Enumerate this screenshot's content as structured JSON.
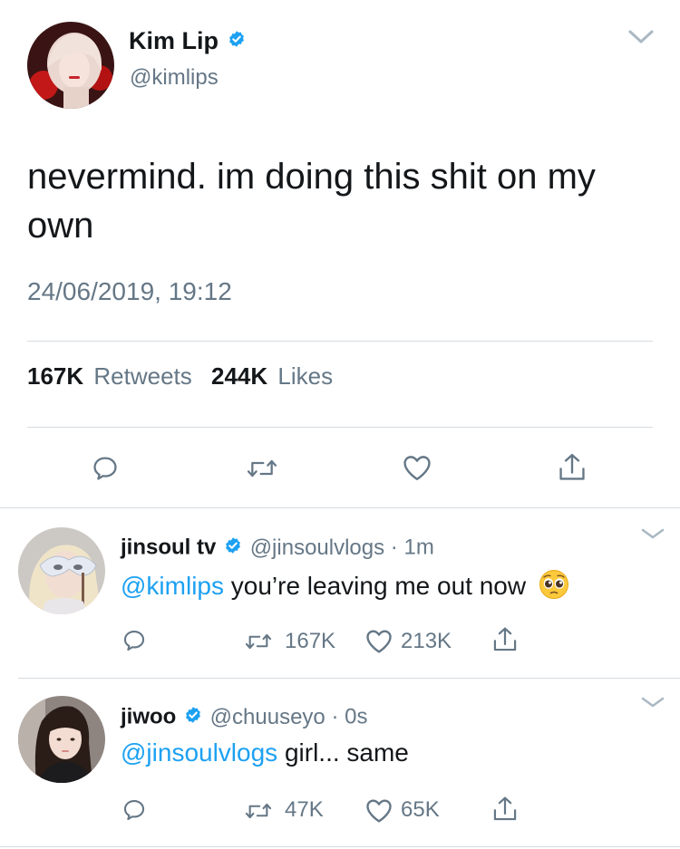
{
  "main_tweet": {
    "display_name": "Kim Lip",
    "handle": "@kimlips",
    "text": "nevermind. im doing this shit on my own",
    "timestamp": "24/06/2019, 19:12",
    "retweets_count": "167K",
    "retweets_label": "Retweets",
    "likes_count": "244K",
    "likes_label": "Likes"
  },
  "replies": [
    {
      "display_name": "jinsoul tv",
      "handle": "@jinsoulvlogs",
      "time": "1m",
      "mention": "@kimlips",
      "text": " you’re leaving me out now",
      "emoji": "pleading-face",
      "retweets": "167K",
      "likes": "213K"
    },
    {
      "display_name": "jiwoo",
      "handle": "@chuuseyo",
      "time": "0s",
      "mention": "@jinsoulvlogs",
      "text": " girl... same",
      "retweets": "47K",
      "likes": "65K"
    }
  ],
  "separator": "·",
  "colors": {
    "text": "#14171a",
    "muted": "#657786",
    "link": "#1da1f2",
    "verified": "#1da1f2",
    "divider": "#d6dbdf"
  }
}
